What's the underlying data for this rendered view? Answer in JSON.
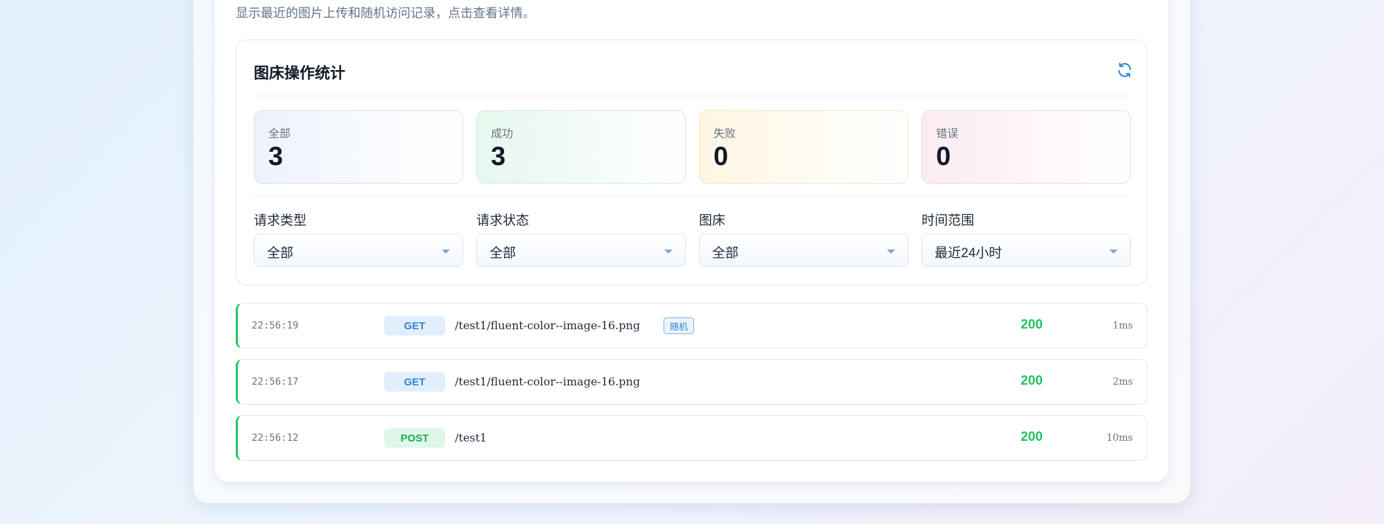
{
  "intro": "显示最近的图片上传和随机访问记录，点击查看详情。",
  "stats": {
    "title": "图床操作统计",
    "refresh_icon": "refresh-icon",
    "cards": [
      {
        "label": "全部",
        "value": "3"
      },
      {
        "label": "成功",
        "value": "3"
      },
      {
        "label": "失败",
        "value": "0"
      },
      {
        "label": "错误",
        "value": "0"
      }
    ]
  },
  "filters": [
    {
      "label": "请求类型",
      "value": "全部"
    },
    {
      "label": "请求状态",
      "value": "全部"
    },
    {
      "label": "图床",
      "value": "全部"
    },
    {
      "label": "时间范围",
      "value": "最近24小时"
    }
  ],
  "logs": [
    {
      "time": "22:56:19",
      "method": "GET",
      "path": "/test1/fluent-color--image-16.png",
      "badge": "随机",
      "status": "200",
      "duration": "1ms"
    },
    {
      "time": "22:56:17",
      "method": "GET",
      "path": "/test1/fluent-color--image-16.png",
      "badge": "",
      "status": "200",
      "duration": "2ms"
    },
    {
      "time": "22:56:12",
      "method": "POST",
      "path": "/test1",
      "badge": "",
      "status": "200",
      "duration": "10ms"
    }
  ],
  "colors": {
    "accent": "#2f86d6",
    "success": "#22c55e",
    "post": "#1fa955"
  }
}
